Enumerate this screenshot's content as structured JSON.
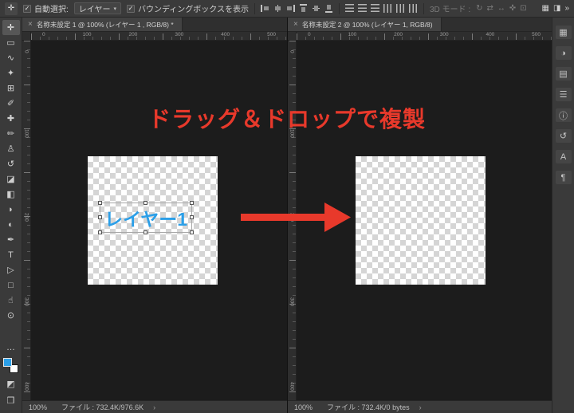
{
  "options_bar": {
    "tool_glyph": "✛",
    "check_glyph": "✓",
    "caret_glyph": "▾",
    "auto_select_label": "自動選択:",
    "auto_select_value": "レイヤー",
    "show_transform_label": "バウンディングボックスを表示",
    "align_icons": [
      {
        "name": "align-left-icon",
        "class": "ico a-l",
        "glyph": "",
        "interactable": "true"
      },
      {
        "name": "align-horizontal-center-icon",
        "class": "ico a-c",
        "glyph": "",
        "interactable": "true"
      },
      {
        "name": "align-right-icon",
        "class": "ico a-r",
        "glyph": "",
        "interactable": "true"
      },
      {
        "name": "align-top-icon",
        "class": "ico a-t",
        "glyph": "",
        "interactable": "true"
      },
      {
        "name": "align-vertical-center-icon",
        "class": "ico a-m",
        "glyph": "",
        "interactable": "true"
      },
      {
        "name": "align-bottom-icon",
        "class": "ico a-b",
        "glyph": "",
        "interactable": "true"
      }
    ],
    "distribute_icons": [
      {
        "name": "distribute-top-icon",
        "class": "d-v",
        "glyph": "",
        "interactable": "true"
      },
      {
        "name": "distribute-vertical-center-icon",
        "class": "d-v",
        "glyph": "",
        "interactable": "true"
      },
      {
        "name": "distribute-bottom-icon",
        "class": "d-v",
        "glyph": "",
        "interactable": "true"
      },
      {
        "name": "distribute-left-icon",
        "class": "d-h",
        "glyph": "",
        "interactable": "true"
      },
      {
        "name": "distribute-horizontal-center-icon",
        "class": "d-h",
        "glyph": "",
        "interactable": "true"
      },
      {
        "name": "distribute-right-icon",
        "class": "d-h",
        "glyph": "",
        "interactable": "true"
      }
    ],
    "mode_3d_label": "3D モード :",
    "mode_3d_icons": [
      {
        "name": "3d-rotate-icon",
        "class": "ob-glyph muted",
        "glyph": "↻",
        "interactable": "true"
      },
      {
        "name": "3d-roll-icon",
        "class": "ob-glyph muted",
        "glyph": "⇄",
        "interactable": "true"
      },
      {
        "name": "3d-drag-icon",
        "class": "ob-glyph muted",
        "glyph": "↔",
        "interactable": "true"
      },
      {
        "name": "3d-slide-icon",
        "class": "ob-glyph muted",
        "glyph": "✜",
        "interactable": "true"
      },
      {
        "name": "3d-scale-icon",
        "class": "ob-glyph muted",
        "glyph": "⊡",
        "interactable": "true"
      }
    ],
    "right_icons": [
      {
        "name": "arrange-documents-icon",
        "class": "ob-glyph",
        "glyph": "▦",
        "interactable": "true"
      },
      {
        "name": "workspace-icon",
        "class": "ob-glyph",
        "glyph": "◨",
        "interactable": "true"
      },
      {
        "name": "collapse-panels-icon",
        "class": "ob-glyph",
        "glyph": "»",
        "interactable": "true"
      }
    ]
  },
  "toolbar": {
    "tools": [
      {
        "name": "move-tool-icon",
        "glyph": "✛",
        "class": "tool selected",
        "interactable": "true"
      },
      {
        "name": "marquee-tool-icon",
        "glyph": "▭",
        "interactable": "true"
      },
      {
        "name": "lasso-tool-icon",
        "glyph": "∿",
        "interactable": "true"
      },
      {
        "name": "quick-selection-tool-icon",
        "glyph": "✦",
        "interactable": "true"
      },
      {
        "name": "crop-tool-icon",
        "glyph": "⊞",
        "interactable": "true"
      },
      {
        "name": "eyedropper-tool-icon",
        "glyph": "✐",
        "interactable": "true"
      },
      {
        "name": "healing-brush-tool-icon",
        "glyph": "✚",
        "interactable": "true"
      },
      {
        "name": "brush-tool-icon",
        "glyph": "✏",
        "interactable": "true"
      },
      {
        "name": "clone-stamp-tool-icon",
        "glyph": "♙",
        "interactable": "true"
      },
      {
        "name": "history-brush-tool-icon",
        "glyph": "↺",
        "interactable": "true"
      },
      {
        "name": "eraser-tool-icon",
        "glyph": "◪",
        "interactable": "true"
      },
      {
        "name": "gradient-tool-icon",
        "glyph": "◧",
        "interactable": "true"
      },
      {
        "name": "blur-tool-icon",
        "glyph": "◗",
        "interactable": "true"
      },
      {
        "name": "dodge-tool-icon",
        "glyph": "◐",
        "interactable": "true"
      },
      {
        "name": "pen-tool-icon",
        "glyph": "✒",
        "interactable": "true"
      },
      {
        "name": "type-tool-icon",
        "glyph": "T",
        "interactable": "true"
      },
      {
        "name": "path-selection-tool-icon",
        "glyph": "▷",
        "interactable": "true"
      },
      {
        "name": "shape-tool-icon",
        "glyph": "□",
        "interactable": "true"
      },
      {
        "name": "hand-tool-icon",
        "glyph": "☝",
        "interactable": "true"
      },
      {
        "name": "zoom-tool-icon",
        "glyph": "⊙",
        "interactable": "true"
      }
    ],
    "more_glyph": "…",
    "mask_glyph": "◩",
    "screen_glyph": "❒",
    "foreground_color": "#2b9fe8",
    "background_color": "#ffffff"
  },
  "right_strip": {
    "icons": [
      {
        "name": "color-panel-icon",
        "glyph": "▦",
        "interactable": "true"
      },
      {
        "name": "adjustments-panel-icon",
        "glyph": "◑",
        "interactable": "true"
      },
      {
        "name": "libraries-panel-icon",
        "glyph": "▤",
        "interactable": "true"
      },
      {
        "name": "properties-panel-icon",
        "glyph": "☰",
        "interactable": "true"
      },
      {
        "name": "info-panel-icon",
        "glyph": "ⓘ",
        "interactable": "true"
      },
      {
        "name": "history-panel-icon",
        "glyph": "↺",
        "interactable": "true"
      },
      {
        "name": "character-panel-icon",
        "glyph": "A",
        "interactable": "true"
      },
      {
        "name": "paragraph-panel-icon",
        "glyph": "¶",
        "interactable": "true"
      }
    ]
  },
  "documents": [
    {
      "close_glyph": "×",
      "title": "名称未設定 1 @ 100% (レイヤー 1 , RGB/8) *",
      "ruler_h": [
        "0",
        "100",
        "200",
        "300",
        "400",
        "500"
      ],
      "ruler_v": [
        "0",
        "100",
        "200",
        "300",
        "400"
      ],
      "layer_text": "レイヤー1",
      "status": {
        "zoom": "100%",
        "info": "ファイル : 732.4K/976.6K",
        "chevron": "›"
      }
    },
    {
      "close_glyph": "×",
      "title": "名称未設定 2 @ 100% (レイヤー 1, RGB/8)",
      "ruler_h": [
        "0",
        "100",
        "200",
        "300",
        "400",
        "500"
      ],
      "ruler_v": [
        "0",
        "100",
        "200",
        "300",
        "400"
      ],
      "status": {
        "zoom": "100%",
        "info": "ファイル : 732.4K/0 bytes",
        "chevron": "›"
      }
    }
  ],
  "annotation": {
    "title": "ドラッグ＆ドロップで複製",
    "color": "#e8392b"
  }
}
